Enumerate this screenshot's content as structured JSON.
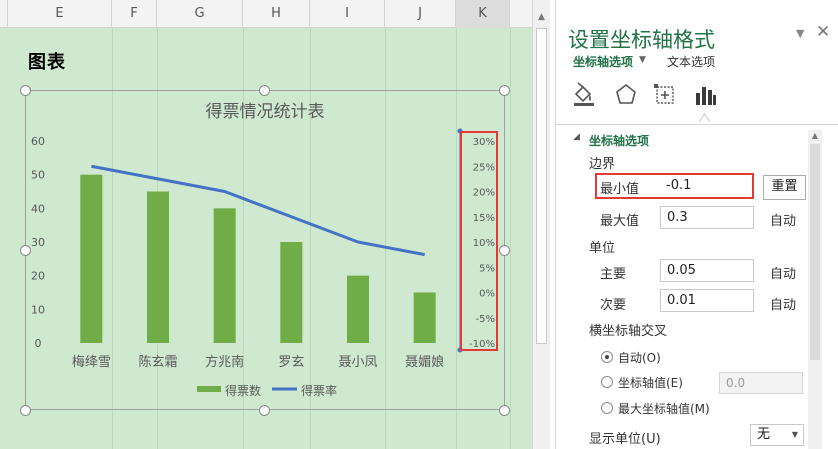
{
  "sheet": {
    "columns": [
      "E",
      "F",
      "G",
      "H",
      "I",
      "J",
      "K"
    ],
    "title": "图表"
  },
  "chart_data": {
    "type": "bar",
    "title": "得票情况统计表",
    "categories": [
      "梅绛雪",
      "陈玄霜",
      "方兆南",
      "罗玄",
      "聂小凤",
      "聂媚娘"
    ],
    "series": [
      {
        "name": "得票数",
        "type": "bar",
        "color": "#70ad47",
        "values": [
          50,
          45,
          40,
          30,
          20,
          15
        ],
        "axis": "left"
      },
      {
        "name": "得票率",
        "type": "line",
        "color": "#4472c4",
        "values": [
          0.25,
          0.225,
          0.2,
          0.15,
          0.1,
          0.075
        ],
        "axis": "right"
      }
    ],
    "left_axis": {
      "min": 0,
      "max": 60,
      "ticks": [
        "60",
        "50",
        "40",
        "30",
        "20",
        "10",
        "0"
      ]
    },
    "right_axis": {
      "min": -0.1,
      "max": 0.3,
      "ticks": [
        "30%",
        "25%",
        "20%",
        "15%",
        "10%",
        "5%",
        "0%",
        "-5%",
        "-10%"
      ]
    },
    "legend_position": "bottom",
    "grid": false
  },
  "pane": {
    "title": "设置坐标轴格式",
    "tab_axis_options": "坐标轴选项",
    "tab_text_options": "文本选项",
    "section_axis_options": "坐标轴选项",
    "bounds_label": "边界",
    "min_label": "最小值",
    "min_value": "-0.1",
    "reset_button": "重置",
    "max_label": "最大值",
    "max_value": "0.3",
    "max_auto": "自动",
    "units_label": "单位",
    "major_label": "主要",
    "major_value": "0.05",
    "major_auto": "自动",
    "minor_label": "次要",
    "minor_value": "0.01",
    "minor_auto": "自动",
    "cross_label": "横坐标轴交叉",
    "cross_auto": "自动(O)",
    "cross_value_label": "坐标轴值(E)",
    "cross_value": "0.0",
    "cross_max_label": "最大坐标轴值(M)",
    "display_units_label": "显示单位(U)",
    "display_units_value": "无"
  }
}
